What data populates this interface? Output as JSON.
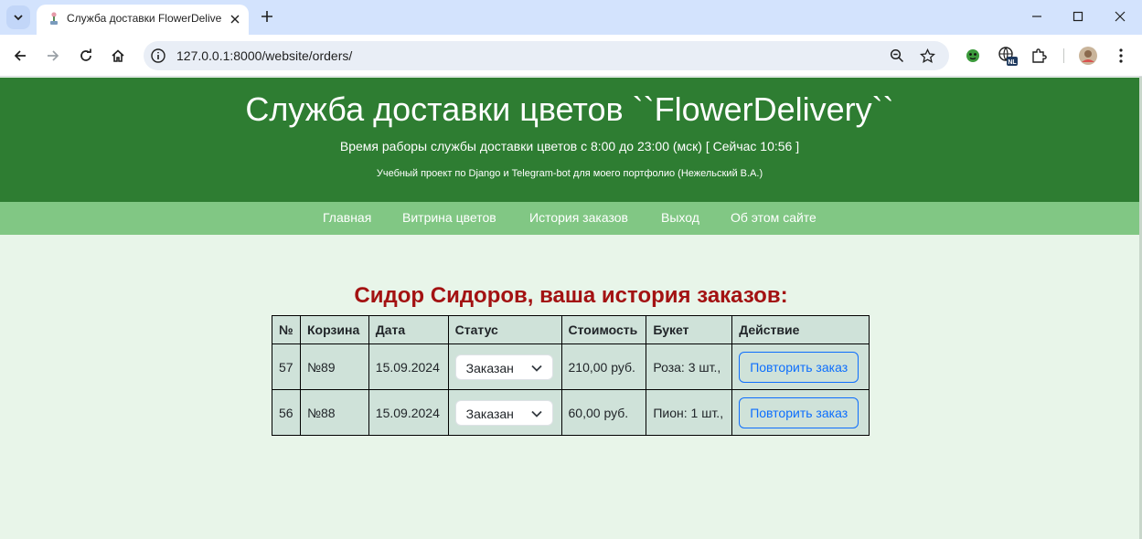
{
  "browser": {
    "tab_title": "Служба доставки FlowerDelivery",
    "url": "127.0.0.1:8000/website/orders/"
  },
  "header": {
    "title": "Служба доставки цветов ``FlowerDelivery``",
    "hours": "Время раборы службы доставки цветов с 8:00 до 23:00 (мск) [ Сейчас 10:56 ]",
    "subtitle": "Учебный проект по Django и Telegram-bot для моего портфолио (Нежельский В.А.)"
  },
  "nav": {
    "items": [
      "Главная",
      "Витрина цветов",
      "История заказов",
      "Выход",
      "Об этом сайте"
    ]
  },
  "orders": {
    "heading": "Сидор Сидоров, ваша история заказов:",
    "columns": [
      "№",
      "Корзина",
      "Дата",
      "Статус",
      "Стоимость",
      "Букет",
      "Действие"
    ],
    "rows": [
      {
        "id": "57",
        "cart": "№89",
        "date": "15.09.2024",
        "status": "Заказан",
        "cost": "210,00 руб.",
        "bouquet": "Роза: 3 шт.,",
        "action": "Повторить заказ"
      },
      {
        "id": "56",
        "cart": "№88",
        "date": "15.09.2024",
        "status": "Заказан",
        "cost": "60,00 руб.",
        "bouquet": "Пион: 1 шт.,",
        "action": "Повторить заказ"
      }
    ]
  },
  "colors": {
    "header_bg": "#2e7d32",
    "nav_bg": "#81c784",
    "page_bg": "#e8f5e9",
    "heading_text": "#a31212",
    "table_bg": "#cfe2d9",
    "button_outline": "#0d6efd"
  },
  "icons": [
    "tab-search-icon",
    "flower-favicon",
    "close-icon",
    "plus-icon",
    "minimize-icon",
    "maximize-icon",
    "window-close-icon",
    "back-icon",
    "forward-icon",
    "reload-icon",
    "home-icon",
    "site-info-icon",
    "zoom-icon",
    "bookmark-star-icon",
    "extension-icon",
    "puzzle-icon",
    "profile-avatar",
    "more-menu-icon"
  ]
}
